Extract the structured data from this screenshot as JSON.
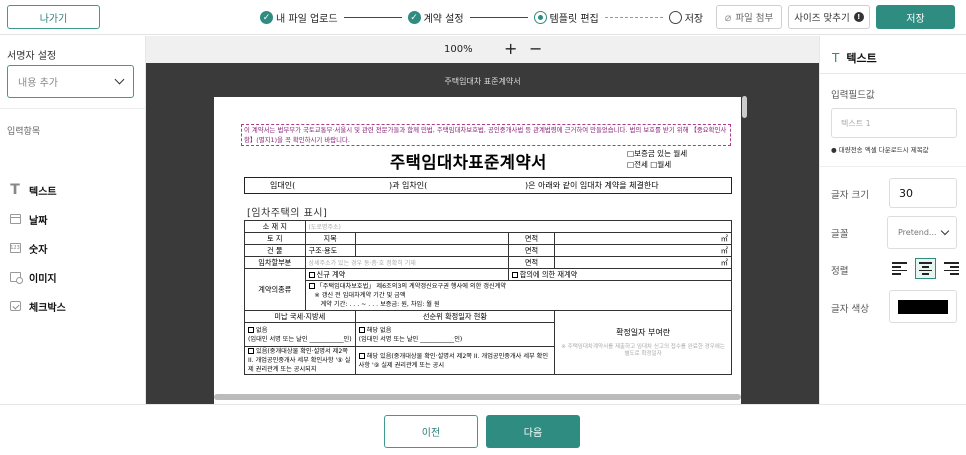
{
  "topbar": {
    "exit_label": "나가기",
    "steps": [
      {
        "label": "내 파일 업로드",
        "state": "done"
      },
      {
        "label": "계약 설정",
        "state": "done"
      },
      {
        "label": "템플릿 편집",
        "state": "current"
      },
      {
        "label": "저장",
        "state": "todo"
      }
    ],
    "attach_label": "파일 첨부",
    "fit_label": "사이즈 맞추기",
    "save_label": "저장"
  },
  "left": {
    "signer_title": "서명자 설정",
    "dropdown_value": "내용 추가",
    "items_title": "입력항목",
    "items": [
      {
        "label": "텍스트",
        "icon": "text-icon"
      },
      {
        "label": "날짜",
        "icon": "calendar-icon"
      },
      {
        "label": "숫자",
        "icon": "number-icon"
      },
      {
        "label": "이미지",
        "icon": "image-icon"
      },
      {
        "label": "체크박스",
        "icon": "checkbox-icon"
      }
    ]
  },
  "canvas": {
    "zoom": "100%",
    "zoom_in": "+",
    "zoom_out": "−",
    "doc_title": "주택임대차 표준계약서"
  },
  "doc": {
    "notice": "이 계약서는 법무부가 국토교통부·서울시 및 관련 전문가들과 함께 민법, 주택임대차보호법, 공인중개사법 등 관계법령에 근거하여 만들었습니다. 법의 보호를 받기 위해 【중요확인사항】(별지1)을 꼭 확인하시기 바랍니다.",
    "title": "주택임대차표준계약서",
    "kind_1": "□보증금 있는 월세",
    "kind_2": "□전세    □월세",
    "party_a": "임대인(",
    "party_b": ")과 임차인(",
    "party_c": ")은 아래와 같이 임대차 계약을 체결한다",
    "section": "[임차주택의 표시]",
    "row_location": "소 재 지",
    "row_location_hint": "(도로명주소)",
    "row_land": "토    지",
    "row_land_type": "지목",
    "row_building": "건    물",
    "row_building_type": "구조·용도",
    "area_label": "면적",
    "area_unit": "㎡",
    "row_leased": "임차할부분",
    "row_leased_hint": "상세주소가 있는 경우 동·층·호 정확히 기재",
    "contract_type": "계약의종류",
    "new_contract": "신규 계약",
    "agreed_recontract": "합의에 의한 재계약",
    "renewal": "「주택임대차보호법」 제6조의3의 계약갱신요구권 행사에 의한 갱신계약",
    "renewal_note": "※ 갱신 전 임대차계약 기간 및 금액",
    "renewal_period": "계약 기간:      .     .     . ~     .     .     .    보증금:                  원,  차임: 월             원",
    "tax_header": "미납 국세·지방세",
    "priority_header": "선순위 확정일자 현황",
    "fixed_date": "확정일자 부여란",
    "none": "없음",
    "none_2": "해당 없음",
    "sign_note": "(임대인 서명 또는 날인 ___________인)",
    "exists_note": "있음(중개대상물 확인·설명서 제2쪽 II. 개업공인중개사 세부 확인사항 '⑨ 실제 권리관계 또는 공시되지",
    "exists_note_2": "해당 있음(중개대상물 확인·설명서 제2쪽 II. 개업공인중개사 세부 확인사항 '⑨ 실제 권리관계 또는 공시",
    "fixed_note": "※ 주택임대차계약서를 제출하고 임대차 신고의 접수를 완료한 경우에는 별도로 확정일자"
  },
  "right": {
    "title": "텍스트",
    "input_label": "입력필드값",
    "input_placeholder": "텍스트 1",
    "note": "● 대량전송 엑셀 다운로드시 제목값",
    "size_label": "글자 크기",
    "size_value": "30",
    "font_label": "글꼴",
    "font_value": "Pretend...",
    "align_label": "정렬",
    "align_selected": "center",
    "color_label": "글자 색상",
    "text_color": "#000000"
  },
  "bottom": {
    "prev_label": "이전",
    "next_label": "다음"
  },
  "colors": {
    "accent": "#2e8d80",
    "notice": "#8b2477"
  }
}
